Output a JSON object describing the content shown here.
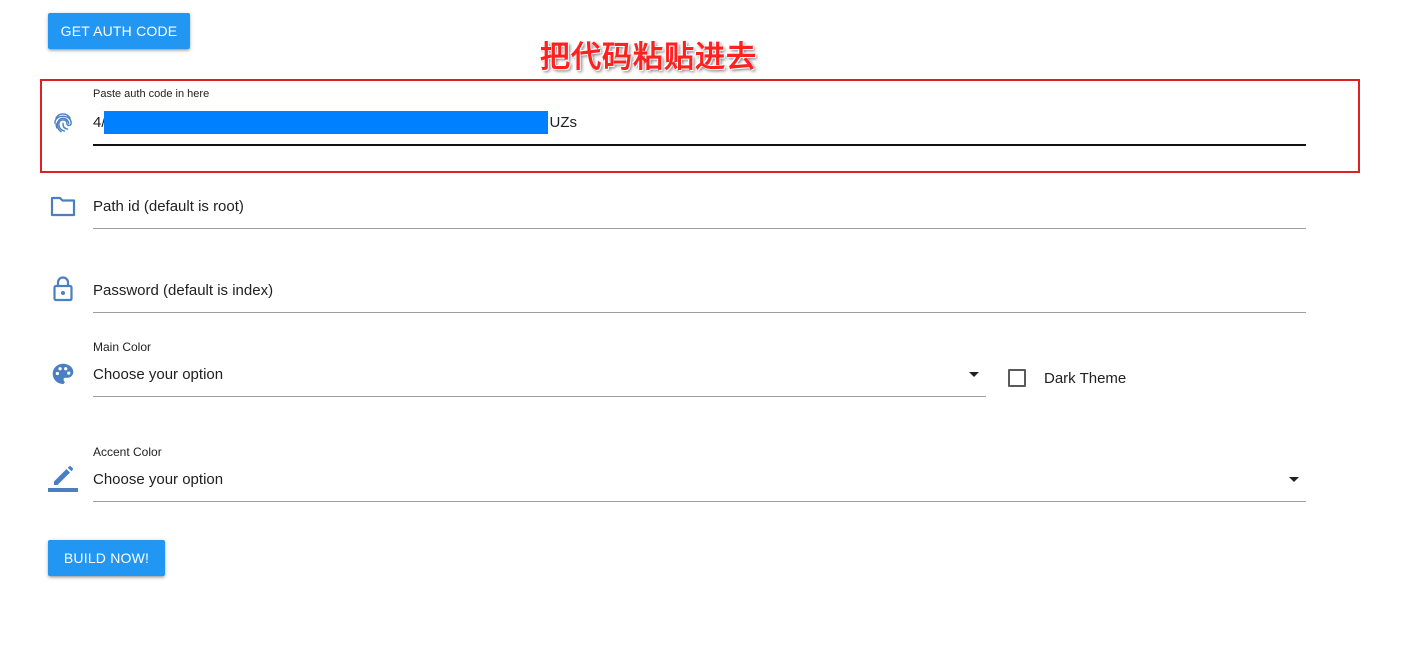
{
  "buttons": {
    "get_auth_code": "GET AUTH CODE",
    "build_now": "BUILD NOW!"
  },
  "annotation": {
    "text": "把代码粘贴进去",
    "color": "#ff2020"
  },
  "auth_code": {
    "label": "Paste auth code in here",
    "value_prefix": "4/",
    "value_suffix": "UZs",
    "icon": "fingerprint-icon"
  },
  "path_id": {
    "placeholder": "Path id (default is root)",
    "icon": "folder-icon"
  },
  "password": {
    "placeholder": "Password (default is index)",
    "icon": "lock-icon"
  },
  "main_color": {
    "label": "Main Color",
    "selected": "Choose your option",
    "icon": "palette-icon"
  },
  "dark_theme": {
    "label": "Dark Theme",
    "checked": false
  },
  "accent_color": {
    "label": "Accent Color",
    "selected": "Choose your option",
    "icon": "pencil-icon"
  },
  "colors": {
    "primary": "#2196f3",
    "icon": "#4a7fc1",
    "redaction": "#0080ff",
    "highlight_border": "#e02020"
  }
}
